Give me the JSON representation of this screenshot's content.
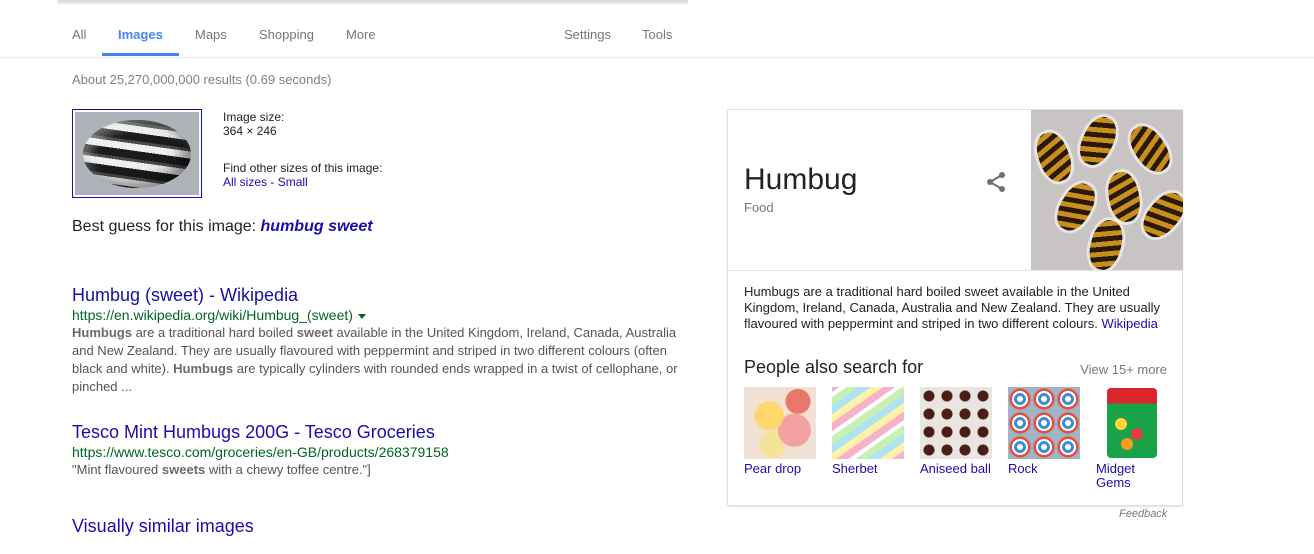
{
  "nav": {
    "tabs": [
      {
        "label": "All"
      },
      {
        "label": "Images"
      },
      {
        "label": "Maps"
      },
      {
        "label": "Shopping"
      },
      {
        "label": "More"
      }
    ],
    "settings": "Settings",
    "tools": "Tools"
  },
  "stats": "About 25,270,000,000 results (0.69 seconds)",
  "image_info": {
    "size_label": "Image size:",
    "size_value": "364 × 246",
    "other_sizes_label": "Find other sizes of this image:",
    "all_sizes": "All sizes",
    "separator": " - ",
    "small": "Small"
  },
  "best_guess": {
    "label": "Best guess for this image: ",
    "value": "humbug sweet"
  },
  "results": [
    {
      "title": "Humbug (sweet) - Wikipedia",
      "url": "https://en.wikipedia.org/wiki/Humbug_(sweet)",
      "snippet": [
        {
          "t": "Humbugs",
          "b": true
        },
        {
          "t": " are a traditional hard boiled ",
          "b": false
        },
        {
          "t": "sweet",
          "b": true
        },
        {
          "t": " available in the United Kingdom, Ireland, Canada, Australia and New Zealand. They are usually flavoured with peppermint and striped in two different colours (often black and white). ",
          "b": false
        },
        {
          "t": "Humbugs",
          "b": true
        },
        {
          "t": " are typically cylinders with rounded ends wrapped in a twist of cellophane, or pinched ...",
          "b": false
        }
      ]
    },
    {
      "title": "Tesco Mint Humbugs 200G - Tesco Groceries",
      "url": "https://www.tesco.com/groceries/en-GB/products/268379158",
      "snippet": [
        {
          "t": "\"Mint flavoured ",
          "b": false
        },
        {
          "t": "sweets",
          "b": true
        },
        {
          "t": " with a chewy toffee centre.\"]",
          "b": false
        }
      ]
    }
  ],
  "visually_similar": "Visually similar images",
  "knowledge_panel": {
    "title": "Humbug",
    "subtitle": "Food",
    "description": "Humbugs are a traditional hard boiled sweet available in the United Kingdom, Ireland, Canada, Australia and New Zealand. They are usually flavoured with peppermint and striped in two different colours. ",
    "source_link": "Wikipedia",
    "people_also_search_title": "People also search for",
    "view_more": "View 15+ more",
    "people_also_search": [
      {
        "label": "Pear drop"
      },
      {
        "label": "Sherbet"
      },
      {
        "label": "Aniseed ball"
      },
      {
        "label": "Rock"
      },
      {
        "label": "Midget Gems"
      }
    ]
  },
  "feedback": "Feedback",
  "colors": {
    "link": "#1a0dab",
    "url_green": "#006621",
    "accent_blue": "#4285f4"
  }
}
